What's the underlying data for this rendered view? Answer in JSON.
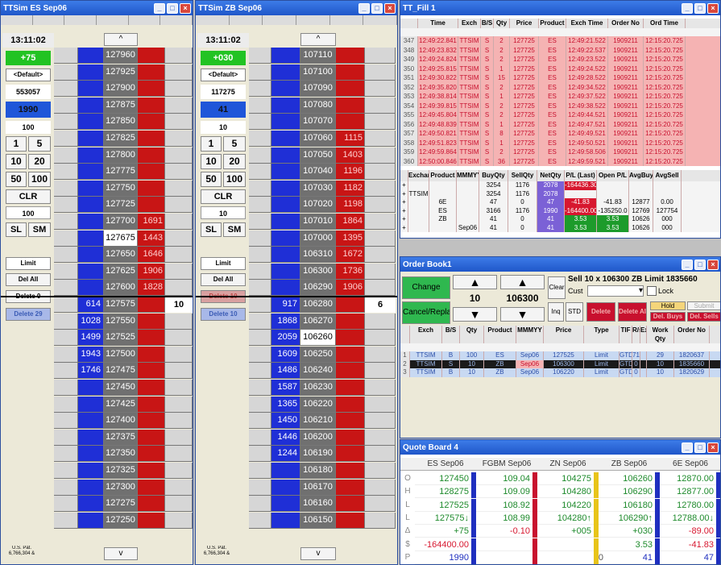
{
  "ladder_es": {
    "title": "TTSim ES Sep06",
    "time": "13:11:02",
    "net_position": "+75",
    "account": "<Default>",
    "order_id": "553057",
    "qty_highlight": "1990",
    "default_qty": "100",
    "qty_buttons": [
      "1",
      "5",
      "10",
      "20",
      "50",
      "100"
    ],
    "clr": "CLR",
    "qty_input": "100",
    "sl": "SL",
    "sm": "SM",
    "order_type": "Limit",
    "del_all": "Del All",
    "delete_0": "Delete 0",
    "delete_n": "Delete 29",
    "footer": "U.S. Pat. 6,766,304 &",
    "up": "^",
    "down": "v",
    "work_qty": "10",
    "rows": [
      {
        "price": "127960",
        "bid": "",
        "ask": ""
      },
      {
        "price": "127925",
        "bid": "",
        "ask": ""
      },
      {
        "price": "127900",
        "bid": "",
        "ask": ""
      },
      {
        "price": "127875",
        "bid": "",
        "ask": ""
      },
      {
        "price": "127850",
        "bid": "",
        "ask": ""
      },
      {
        "price": "127825",
        "bid": "",
        "ask": ""
      },
      {
        "price": "127800",
        "bid": "",
        "ask": ""
      },
      {
        "price": "127775",
        "bid": "",
        "ask": ""
      },
      {
        "price": "127750",
        "bid": "",
        "ask": ""
      },
      {
        "price": "127725",
        "bid": "",
        "ask": ""
      },
      {
        "price": "127700",
        "bid": "",
        "ask": "1691"
      },
      {
        "price": "127675",
        "bid": "",
        "ask": "1443"
      },
      {
        "price": "127650",
        "bid": "",
        "ask": "1646"
      },
      {
        "price": "127625",
        "bid": "",
        "ask": "1906"
      },
      {
        "price": "127600",
        "bid": "",
        "ask": "1828"
      },
      {
        "price": "127575",
        "bid": "614",
        "ask": ""
      },
      {
        "price": "127550",
        "bid": "1028",
        "ask": ""
      },
      {
        "price": "127525",
        "bid": "1499",
        "ask": ""
      },
      {
        "price": "127500",
        "bid": "1943",
        "ask": ""
      },
      {
        "price": "127475",
        "bid": "1746",
        "ask": ""
      },
      {
        "price": "127450",
        "bid": "",
        "ask": ""
      },
      {
        "price": "127425",
        "bid": "",
        "ask": ""
      },
      {
        "price": "127400",
        "bid": "",
        "ask": ""
      },
      {
        "price": "127375",
        "bid": "",
        "ask": ""
      },
      {
        "price": "127350",
        "bid": "",
        "ask": ""
      },
      {
        "price": "127325",
        "bid": "",
        "ask": ""
      },
      {
        "price": "127300",
        "bid": "",
        "ask": ""
      },
      {
        "price": "127275",
        "bid": "",
        "ask": ""
      },
      {
        "price": "127250",
        "bid": "",
        "ask": ""
      }
    ]
  },
  "ladder_zb": {
    "title": "TTSim ZB Sep06",
    "time": "13:11:02",
    "net_position": "+030",
    "account": "<Default>",
    "order_id": "117275",
    "qty_highlight": "41",
    "default_qty": "10",
    "qty_buttons": [
      "1",
      "5",
      "10",
      "20",
      "50",
      "100"
    ],
    "clr": "CLR",
    "qty_input": "10",
    "sl": "SL",
    "sm": "SM",
    "order_type": "Limit",
    "del_all": "Del All",
    "delete_0": "Delete 10",
    "delete_n": "Delete 10",
    "footer": "U.S. Pat. 6,766,304 &",
    "up": "^",
    "down": "v",
    "work_qty": "6",
    "rows": [
      {
        "price": "107110",
        "bid": "",
        "ask": ""
      },
      {
        "price": "107100",
        "bid": "",
        "ask": ""
      },
      {
        "price": "107090",
        "bid": "",
        "ask": ""
      },
      {
        "price": "107080",
        "bid": "",
        "ask": ""
      },
      {
        "price": "107070",
        "bid": "",
        "ask": ""
      },
      {
        "price": "107060",
        "bid": "",
        "ask": "1115"
      },
      {
        "price": "107050",
        "bid": "",
        "ask": "1403"
      },
      {
        "price": "107040",
        "bid": "",
        "ask": "1196"
      },
      {
        "price": "107030",
        "bid": "",
        "ask": "1182"
      },
      {
        "price": "107020",
        "bid": "",
        "ask": "1198"
      },
      {
        "price": "107010",
        "bid": "",
        "ask": "1864"
      },
      {
        "price": "107000",
        "bid": "",
        "ask": "1395"
      },
      {
        "price": "106310",
        "bid": "",
        "ask": "1672"
      },
      {
        "price": "106300",
        "bid": "",
        "ask": "1736"
      },
      {
        "price": "106290",
        "bid": "",
        "ask": "1906"
      },
      {
        "price": "106280",
        "bid": "917",
        "ask": ""
      },
      {
        "price": "106270",
        "bid": "1868",
        "ask": ""
      },
      {
        "price": "106260",
        "bid": "2059",
        "ask": ""
      },
      {
        "price": "106250",
        "bid": "1609",
        "ask": ""
      },
      {
        "price": "106240",
        "bid": "1486",
        "ask": ""
      },
      {
        "price": "106230",
        "bid": "1587",
        "ask": ""
      },
      {
        "price": "106220",
        "bid": "1365",
        "ask": ""
      },
      {
        "price": "106210",
        "bid": "1450",
        "ask": ""
      },
      {
        "price": "106200",
        "bid": "1446",
        "ask": ""
      },
      {
        "price": "106190",
        "bid": "1244",
        "ask": ""
      },
      {
        "price": "106180",
        "bid": "",
        "ask": ""
      },
      {
        "price": "106170",
        "bid": "",
        "ask": ""
      },
      {
        "price": "106160",
        "bid": "",
        "ask": ""
      },
      {
        "price": "106150",
        "bid": "",
        "ask": ""
      }
    ]
  },
  "fill_window": {
    "title": "TT_Fill 1",
    "headers": [
      "Time",
      "Exch",
      "B/S",
      "Qty",
      "Price",
      "Product",
      "Exch Time",
      "Order No",
      "Ord Time"
    ],
    "row_nums": [
      "347",
      "348",
      "349",
      "350",
      "351",
      "352",
      "353",
      "354",
      "355",
      "356",
      "357",
      "358",
      "359",
      "360"
    ],
    "rows": [
      [
        "12:49:22.841",
        "TTSIM",
        "S",
        "2",
        "127725",
        "ES",
        "12:49:21.522",
        "1909211",
        "12:15:20.725"
      ],
      [
        "12:49:23.832",
        "TTSIM",
        "S",
        "2",
        "127725",
        "ES",
        "12:49:22.537",
        "1909211",
        "12:15:20.725"
      ],
      [
        "12:49:24.824",
        "TTSIM",
        "S",
        "2",
        "127725",
        "ES",
        "12:49:23.522",
        "1909211",
        "12:15:20.725"
      ],
      [
        "12:49:25.815",
        "TTSIM",
        "S",
        "1",
        "127725",
        "ES",
        "12:49:24.522",
        "1909211",
        "12:15:20.725"
      ],
      [
        "12:49:30.822",
        "TTSIM",
        "S",
        "15",
        "127725",
        "ES",
        "12:49:28.522",
        "1909211",
        "12:15:20.725"
      ],
      [
        "12:49:35.820",
        "TTSIM",
        "S",
        "2",
        "127725",
        "ES",
        "12:49:34.522",
        "1909211",
        "12:15:20.725"
      ],
      [
        "12:49:38.814",
        "TTSIM",
        "S",
        "1",
        "127725",
        "ES",
        "12:49:37.522",
        "1909211",
        "12:15:20.725"
      ],
      [
        "12:49:39.815",
        "TTSIM",
        "S",
        "2",
        "127725",
        "ES",
        "12:49:38.522",
        "1909211",
        "12:15:20.725"
      ],
      [
        "12:49:45.804",
        "TTSIM",
        "S",
        "2",
        "127725",
        "ES",
        "12:49:44.521",
        "1909211",
        "12:15:20.725"
      ],
      [
        "12:49:48.839",
        "TTSIM",
        "S",
        "1",
        "127725",
        "ES",
        "12:49:47.521",
        "1909211",
        "12:15:20.725"
      ],
      [
        "12:49:50.821",
        "TTSIM",
        "S",
        "8",
        "127725",
        "ES",
        "12:49:49.521",
        "1909211",
        "12:15:20.725"
      ],
      [
        "12:49:51.823",
        "TTSIM",
        "S",
        "1",
        "127725",
        "ES",
        "12:49:50.521",
        "1909211",
        "12:15:20.725"
      ],
      [
        "12:49:59.864",
        "TTSIM",
        "S",
        "2",
        "127725",
        "ES",
        "12:49:58.506",
        "1909211",
        "12:15:20.725"
      ],
      [
        "12:50:00.846",
        "TTSIM",
        "S",
        "36",
        "127725",
        "ES",
        "12:49:59.521",
        "1909211",
        "12:15:20.725"
      ]
    ],
    "pos_headers": [
      "Exchange",
      "Product",
      "MMMYY",
      "BuyQty",
      "SellQty",
      "NetQty",
      "P/L (Last)",
      "Open P/L",
      "AvgBuy",
      "AvgSell"
    ],
    "pos_rows": [
      [
        "",
        "",
        "",
        "3254",
        "1176",
        "2078",
        "-164436.30",
        "",
        "",
        ""
      ],
      [
        "TTSIM",
        "",
        "",
        "3254",
        "1176",
        "2078",
        "",
        "",
        "",
        ""
      ],
      [
        "",
        "6E",
        "",
        "47",
        "0",
        "47",
        "-41.83",
        "-41.83",
        "12877",
        "0.00"
      ],
      [
        "",
        "ES",
        "",
        "3166",
        "1176",
        "1990",
        "-164400.00",
        "-135250.0",
        "12769",
        "127754"
      ],
      [
        "",
        "ZB",
        "",
        "41",
        "0",
        "41",
        "3.53",
        "3.53",
        "10626",
        "000"
      ],
      [
        "",
        "",
        "Sep06",
        "41",
        "0",
        "41",
        "3.53",
        "3.53",
        "10626",
        "000"
      ]
    ]
  },
  "order_book": {
    "title": "Order Book1",
    "change": "Change",
    "cancel_replace": "Cancel/Replace",
    "qty": "10",
    "price": "106300",
    "clear": "Clear",
    "info": "Sell 10 x 106300 ZB Limit 1835660",
    "cust": "Cust",
    "lock": "Lock",
    "inq": "Inq",
    "std": "STD",
    "delete": "Delete",
    "delete_all": "Delete All",
    "hold": "Hold",
    "submit": "Submit",
    "del_buys": "Del. Buys",
    "del_sells": "Del. Sells",
    "headers": [
      "Exch",
      "B/S",
      "Qty",
      "Product",
      "MMMYY",
      "Price",
      "Type",
      "TIF",
      "R/st/e",
      "Ex",
      "Work Qty",
      "Order No"
    ],
    "rows": [
      [
        "TTSIM",
        "B",
        "100",
        "ES",
        "Sep06",
        "127525",
        "Limit",
        "GTD",
        "71",
        "",
        "29",
        "1820637"
      ],
      [
        "TTSIM",
        "S",
        "10",
        "ZB",
        "Sep06",
        "106300",
        "Limit",
        "GTD",
        "0",
        "",
        "10",
        "1835660"
      ],
      [
        "TTSIM",
        "B",
        "10",
        "ZB",
        "Sep06",
        "106220",
        "Limit",
        "GTD",
        "0",
        "",
        "10",
        "1820629"
      ]
    ]
  },
  "quote_board": {
    "title": "Quote Board 4",
    "row_labels": [
      "O",
      "H",
      "L",
      "L",
      "Δ",
      "$",
      "P"
    ],
    "columns": [
      {
        "name": "ES Sep06",
        "values": [
          "127450",
          "128275",
          "127525",
          "127575↓",
          "+75",
          "-164400.00",
          "1990"
        ],
        "bar": "#1f2fbf"
      },
      {
        "name": "FGBM Sep06",
        "values": [
          "109.04",
          "109.09",
          "108.92",
          "108.99",
          "-0.10",
          "",
          ""
        ],
        "bar": "#c8102e"
      },
      {
        "name": "ZN Sep06",
        "values": [
          "104275",
          "104280",
          "104220",
          "104280↑",
          "+005",
          "",
          ""
        ],
        "bar": "#e8c41a"
      },
      {
        "name": "ZB Sep06",
        "values": [
          "106260",
          "106290",
          "106180",
          "106290↑",
          "+030",
          "3.53",
          "41"
        ],
        "bar": "#1f2fbf"
      },
      {
        "name": "6E Sep06",
        "values": [
          "12870.00",
          "12877.00",
          "12780.00",
          "12788.00↓",
          "-89.00",
          "-41.83",
          "47"
        ],
        "bar": "#1f2fbf"
      }
    ],
    "o_last_p": "0"
  }
}
